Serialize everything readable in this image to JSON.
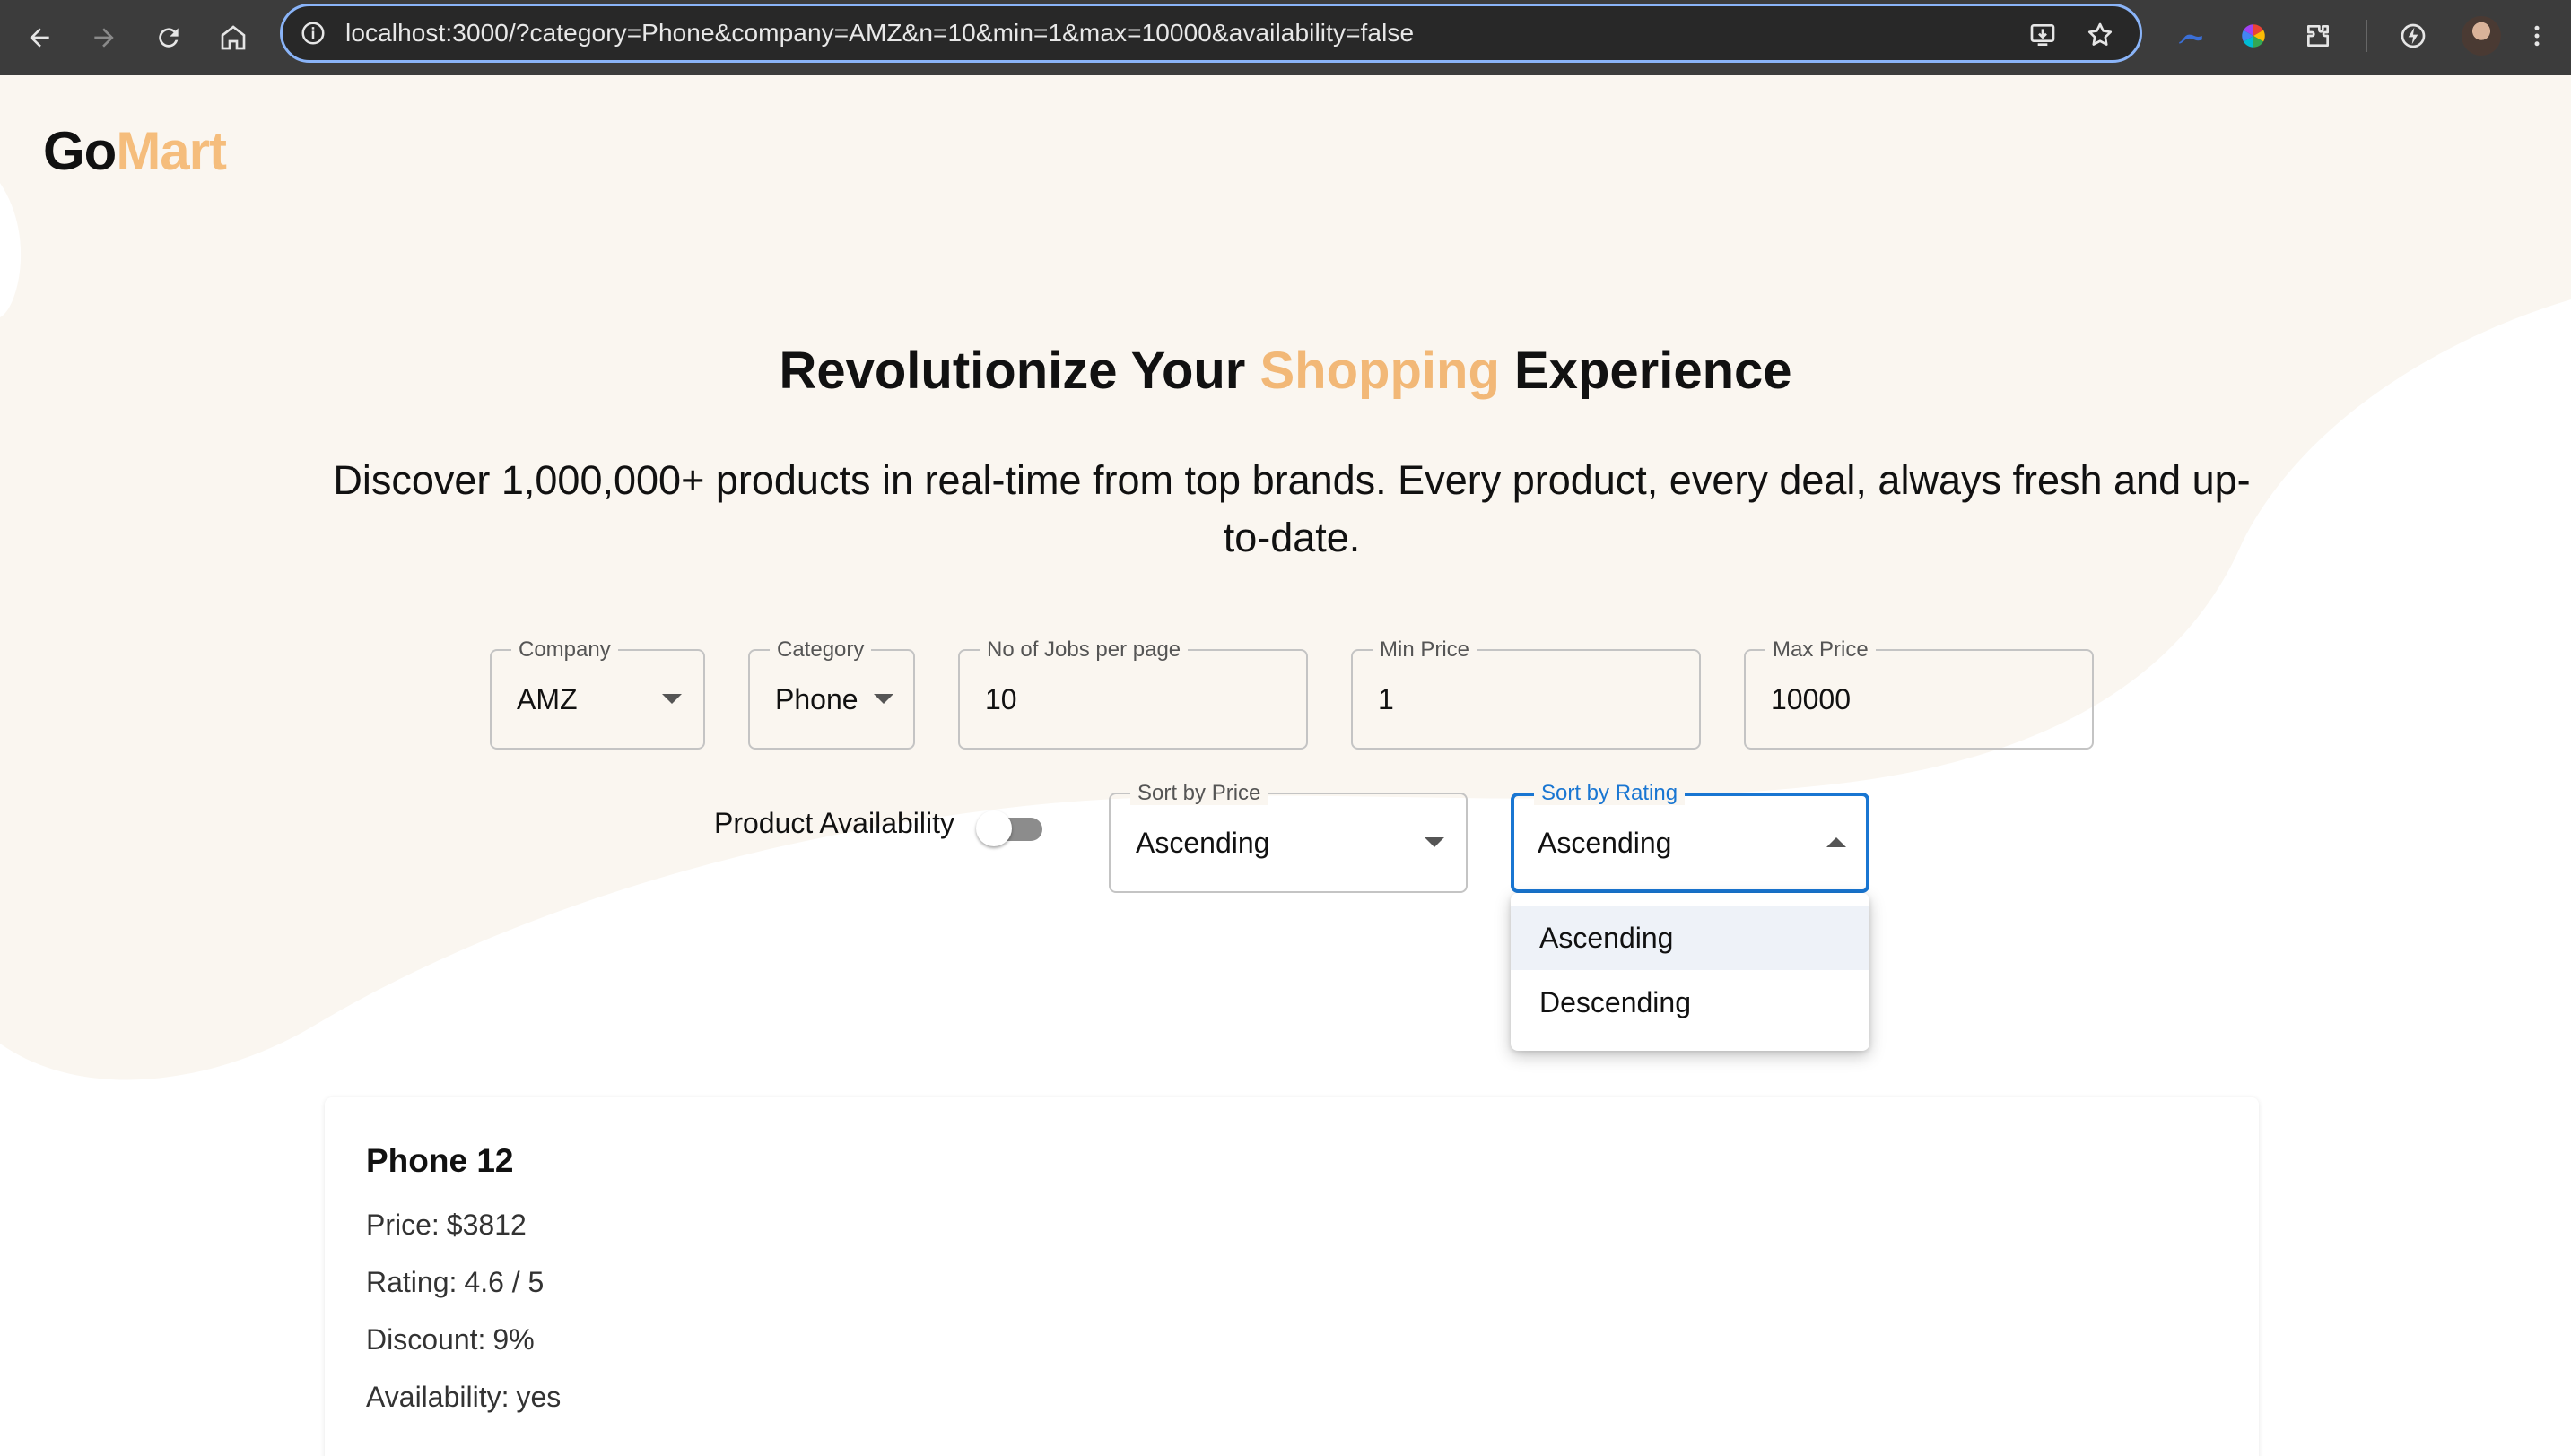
{
  "browser": {
    "url": "localhost:3000/?category=Phone&company=AMZ&n=10&min=1&max=10000&availability=false",
    "icons": [
      "back-icon",
      "forward-icon",
      "reload-icon",
      "home-icon",
      "site-info-icon",
      "install-app-icon",
      "bookmark-star-icon",
      "extension-icons",
      "extensions-puzzle-icon",
      "performance-icon",
      "profile-avatar",
      "menu-kebab-icon"
    ]
  },
  "brand": {
    "part1": "Go",
    "part2": "Mart",
    "accent_color": "#f5bd7c"
  },
  "hero": {
    "headline_before": "Revolutionize Your",
    "headline_accent": "Shopping",
    "headline_after": "Experience",
    "subline": "Discover 1,000,000+ products in real-time from top brands. Every product, every deal, always fresh and up-to-date.",
    "bg_color": "#faf6f0"
  },
  "filters": {
    "company": {
      "label": "Company",
      "value": "AMZ"
    },
    "category": {
      "label": "Category",
      "value": "Phone"
    },
    "per_page": {
      "label": "No of Jobs per page",
      "value": "10"
    },
    "min_price": {
      "label": "Min Price",
      "value": "1"
    },
    "max_price": {
      "label": "Max Price",
      "value": "10000"
    },
    "availability": {
      "label": "Product Availability",
      "checked": false
    },
    "sort_price": {
      "label": "Sort by Price",
      "value": "Ascending"
    },
    "sort_rating": {
      "label": "Sort by Rating",
      "value": "Ascending",
      "open": true,
      "focus_color": "#1976d2"
    }
  },
  "rating_menu": {
    "options": [
      "Ascending",
      "Descending"
    ],
    "selected": "Ascending"
  },
  "products": [
    {
      "name": "Phone 12",
      "price_label": "Price:",
      "price": "$3812",
      "rating_label": "Rating:",
      "rating": "4.6 / 5",
      "discount_label": "Discount:",
      "discount": "9%",
      "availability_label": "Availability:",
      "availability": "yes"
    }
  ]
}
